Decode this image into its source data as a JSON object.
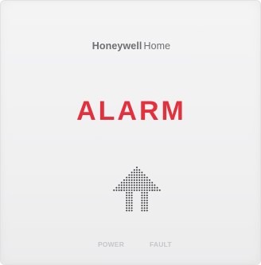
{
  "device": {
    "brand_bold": "Honeywell",
    "brand_light": "Home",
    "status_text": "ALARM",
    "status_color": "#e4303d",
    "indicators": {
      "power_label": "POWER",
      "fault_label": "FAULT"
    },
    "icons": {
      "speaker": "house-shaped-speaker-grille-icon"
    }
  }
}
